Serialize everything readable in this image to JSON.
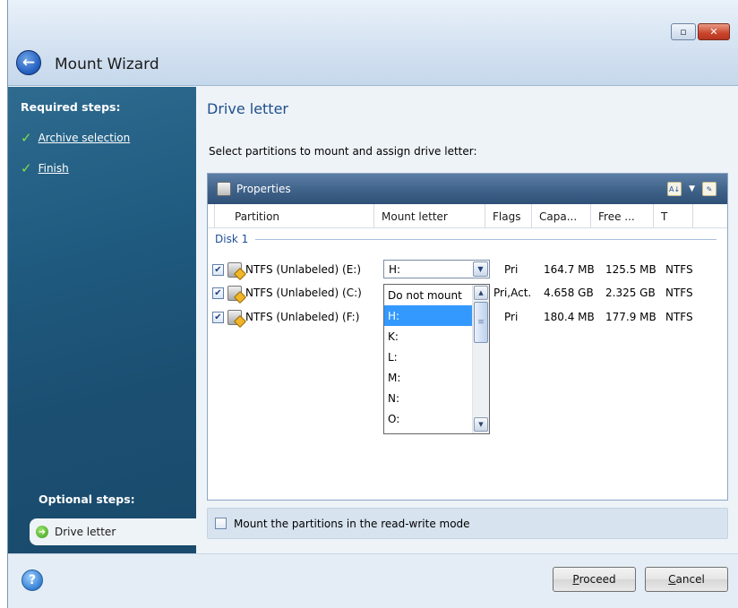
{
  "window": {
    "title": "Mount Wizard",
    "controls": {
      "minimize": "▫",
      "close": "✕"
    }
  },
  "sidebar": {
    "required_heading": "Required steps:",
    "required_items": [
      {
        "label": "Archive selection",
        "done": true
      },
      {
        "label": "Finish",
        "done": true
      }
    ],
    "optional_heading": "Optional steps:",
    "current_item": "Drive letter"
  },
  "main": {
    "title": "Drive letter",
    "instruction": "Select partitions to mount and assign drive letter:",
    "panel_title": "Properties",
    "columns": [
      "Partition",
      "Mount letter",
      "Flags",
      "Capa...",
      "Free ...",
      "T"
    ],
    "disk_label": "Disk 1",
    "partitions": [
      {
        "name": "NTFS (Unlabeled) (E:)",
        "checked": true,
        "flags": "Pri",
        "capacity": "164.7 MB",
        "free": "125.5 MB",
        "type": "NTFS"
      },
      {
        "name": "NTFS (Unlabeled) (C:)",
        "checked": true,
        "flags": "Pri,Act.",
        "capacity": "4.658 GB",
        "free": "2.325 GB",
        "type": "NTFS"
      },
      {
        "name": "NTFS (Unlabeled) (F:)",
        "checked": true,
        "flags": "Pri",
        "capacity": "180.4 MB",
        "free": "177.9 MB",
        "type": "NTFS"
      }
    ],
    "combo_value": "H:",
    "dropdown_options": [
      "Do not mount",
      "H:",
      "K:",
      "L:",
      "M:",
      "N:",
      "O:"
    ],
    "dropdown_selected": "H:",
    "rw_label": "Mount the partitions in the read-write mode",
    "rw_checked": false
  },
  "footer": {
    "proceed_prefix": "",
    "proceed_mnemonic": "P",
    "proceed_rest": "roceed",
    "cancel_mnemonic": "C",
    "cancel_rest": "ancel"
  },
  "colors": {
    "sidebar": "#1f5a7f",
    "accent_title": "#1e4e8a",
    "selection": "#3399ff",
    "panel_header": "#3f6289"
  }
}
